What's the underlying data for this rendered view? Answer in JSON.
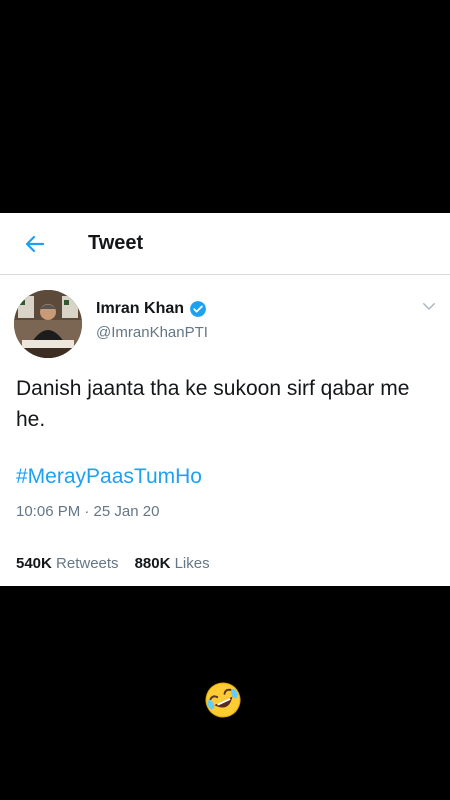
{
  "header": {
    "title": "Tweet",
    "back_icon": "arrow-left-icon"
  },
  "author": {
    "name": "Imran Khan",
    "handle": "@ImranKhanPTI",
    "verified": true,
    "verified_icon": "verified-badge-icon"
  },
  "tweet": {
    "text": "Danish jaanta tha ke sukoon sirf qabar me he.",
    "hashtag": "#MerayPaasTumHo",
    "timestamp": "10:06 PM · 25 Jan 20"
  },
  "stats": {
    "retweets_count": "540K",
    "retweets_label": "Retweets",
    "likes_count": "880K",
    "likes_label": "Likes"
  },
  "overlay": {
    "emoji": "rolling-on-the-floor-laughing-emoji"
  },
  "colors": {
    "accent": "#1da1f2",
    "text_primary": "#14171a",
    "text_secondary": "#657786",
    "background": "#000000"
  }
}
